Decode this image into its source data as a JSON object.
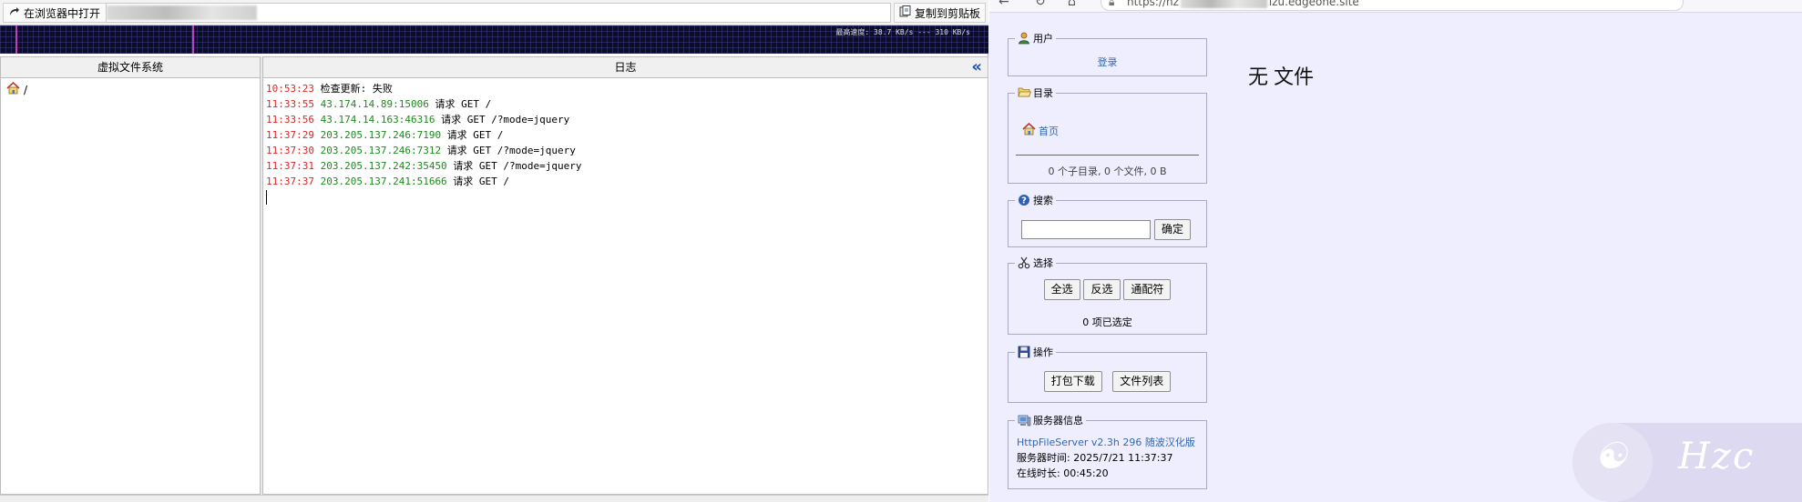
{
  "app": {
    "toolbar": {
      "open_in_browser_label": "在浏览器中打开",
      "copy_to_clipboard_label": "复制到剪贴板"
    },
    "graph": {
      "speed_text": "最高速度: 38.7 KB/s --- 310 KB/s"
    },
    "vfs": {
      "header": "虚拟文件系统",
      "root_label": "/"
    },
    "log": {
      "header": "日志",
      "lines": [
        {
          "time": "10:53:23",
          "ip": "",
          "msg": "检查更新: 失败"
        },
        {
          "time": "11:33:55",
          "ip": "43.174.14.89:15006",
          "msg": "请求 GET /"
        },
        {
          "time": "11:33:56",
          "ip": "43.174.14.163:46316",
          "msg": "请求 GET /?mode=jquery"
        },
        {
          "time": "11:37:29",
          "ip": "203.205.137.246:7190",
          "msg": "请求 GET /"
        },
        {
          "time": "11:37:30",
          "ip": "203.205.137.246:7312",
          "msg": "请求 GET /?mode=jquery"
        },
        {
          "time": "11:37:31",
          "ip": "203.205.137.242:35450",
          "msg": "请求 GET /?mode=jquery"
        },
        {
          "time": "11:37:37",
          "ip": "203.205.137.241:51666",
          "msg": "请求 GET /"
        }
      ]
    }
  },
  "browser": {
    "address": {
      "prefix": "https://hz",
      "suffix": "izu.edgeone.site"
    },
    "user": {
      "title": "用户",
      "login_link": "登录"
    },
    "folder": {
      "title": "目录",
      "home_link": "首页",
      "stats": "0 个子目录, 0 个文件, 0 B"
    },
    "search": {
      "title": "搜索",
      "input_value": "",
      "submit_label": "确定"
    },
    "select": {
      "title": "选择",
      "select_all": "全选",
      "invert": "反选",
      "wildcard": "通配符",
      "selected_count": "0 项已选定"
    },
    "actions": {
      "title": "操作",
      "archive": "打包下载",
      "file_list": "文件列表"
    },
    "server_info": {
      "title": "服务器信息",
      "version_link": "HttpFileServer v2.3h 296 随波汉化版",
      "server_time": "服务器时间: 2025/7/21 11:37:37",
      "uptime": "在线时长: 00:45:20"
    },
    "main": {
      "no_files": "无 文件"
    },
    "watermark": "Hzc"
  },
  "colors": {
    "log_time": "#e12525",
    "log_ip": "#1e8a1e",
    "link": "#3467b3",
    "browser_bg": "#eeeefe",
    "graph_bg": "#0c0c24"
  }
}
